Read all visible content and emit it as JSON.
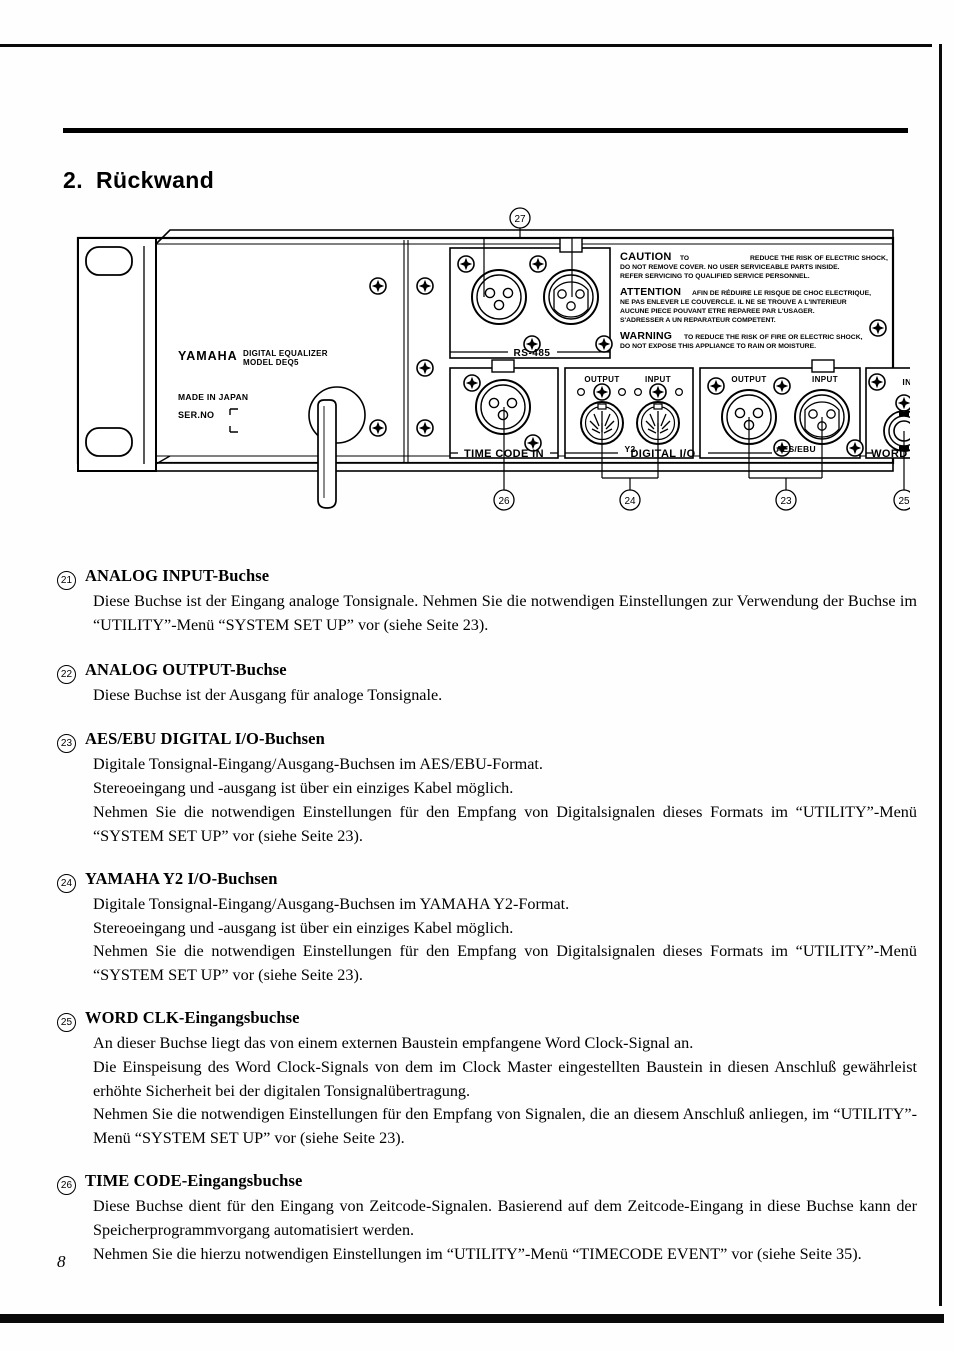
{
  "document": {
    "chapter_number": "2.",
    "chapter_title": "Rückwand",
    "page_number": "8"
  },
  "figure": {
    "name": "rear-panel-diagram",
    "brand": "YAMAHA",
    "product_line_1": "DIGITAL EQUALIZER",
    "product_line_2": "MODEL DEQ5",
    "made_in": "MADE IN JAPAN",
    "serial_label": "SER.NO",
    "rs485_label": "RS-485",
    "caution": {
      "caution_word": "CAUTION",
      "caution_to": "TO",
      "caution_line1": "REDUCE THE RISK OF ELECTRIC SHOCK,",
      "caution_line2": "DO NOT REMOVE COVER. NO USER SERVICEABLE PARTS INSIDE.",
      "caution_line3": "REFER SERVICING TO QUALIFIED SERVICE PERSONNEL.",
      "attention_word": "ATTENTION",
      "attention_line1": "AFIN DE RÉDUIRE LE RISQUE DE CHOC ELECTRIQUE,",
      "attention_line2": "NE PAS ENLEVER LE COUVERCLE. IL NE SE TROUVE A L'INTERIEUR",
      "attention_line3": "AUCUNE PIECE POUVANT ETRE REPAREE PAR L'USAGER.",
      "attention_line4": "S'ADRESSER A UN REPARATEUR COMPETENT.",
      "warning_word": "WARNING",
      "warning_line1": "TO REDUCE THE RISK OF FIRE OR ELECTRIC SHOCK,",
      "warning_line2": "DO NOT EXPOSE THIS APPLIANCE TO RAIN OR MOISTURE."
    },
    "connector_labels": {
      "time_code_in": "TIME CODE IN",
      "y2_output": "OUTPUT",
      "y2_input": "INPUT",
      "y2": "Y2",
      "digital_io": "DIGITAL I/O",
      "aes_output": "OUTPUT",
      "aes_input": "INPUT",
      "aes_ebu": "AES/EBU",
      "word_clk": "WORD CLK",
      "word_clk_in": "IN"
    },
    "callouts": {
      "c27": "27",
      "c26": "26",
      "c24": "24",
      "c23": "23",
      "c25": "25"
    }
  },
  "sections": [
    {
      "callout": "21",
      "title": "ANALOG INPUT-Buchse",
      "lines": [
        "Diese Buchse ist der Eingang analoge Tonsignale. Nehmen Sie die notwendigen Einstellungen zur Verwendung der Buchse im “UTILITY”-Menü “SYSTEM SET UP” vor (siehe Seite 23)."
      ]
    },
    {
      "callout": "22",
      "title": "ANALOG OUTPUT-Buchse",
      "lines": [
        "Diese Buchse ist der Ausgang für analoge Tonsignale."
      ]
    },
    {
      "callout": "23",
      "title": "AES/EBU DIGITAL I/O-Buchsen",
      "lines": [
        "Digitale Tonsignal-Eingang/Ausgang-Buchsen im AES/EBU-Format.",
        "Stereoeingang und -ausgang ist über ein einziges Kabel möglich.",
        "Nehmen Sie die notwendigen Einstellungen für den Empfang von Digitalsignalen dieses Formats im “UTILITY”-Menü “SYSTEM SET UP” vor (siehe Seite 23)."
      ]
    },
    {
      "callout": "24",
      "title": "YAMAHA Y2 I/O-Buchsen",
      "lines": [
        "Digitale Tonsignal-Eingang/Ausgang-Buchsen im YAMAHA Y2-Format.",
        "Stereoeingang und -ausgang ist über ein einziges Kabel möglich.",
        "Nehmen Sie die notwendigen Einstellungen für den Empfang von Digitalsignalen dieses Formats im “UTILITY”-Menü “SYSTEM SET UP” vor (siehe Seite 23)."
      ]
    },
    {
      "callout": "25",
      "title": "WORD CLK-Eingangsbuchse",
      "lines": [
        "An dieser Buchse liegt das von einem externen Baustein empfangene Word Clock-Signal an.",
        "Die Einspeisung des Word Clock-Signals von dem im Clock Master eingestellten Baustein in diesen Anschluß gewährleist erhöhte Sicherheit bei der digitalen Tonsignalübertragung.",
        "Nehmen Sie die notwendigen Einstellungen für den Empfang von Signalen, die an diesem Anschluß anliegen, im “UTILITY”-Menü “SYSTEM SET UP” vor (siehe Seite 23)."
      ]
    },
    {
      "callout": "26",
      "title": "TIME CODE-Eingangsbuchse",
      "lines": [
        "Diese Buchse dient für den Eingang von Zeitcode-Signalen. Basierend auf dem Zeitcode-Eingang in diese Buchse kann der Speicherprogrammvorgang automatisiert werden.",
        "Nehmen Sie die hierzu notwendigen Einstellungen im “UTILITY”-Menü “TIMECODE EVENT” vor (siehe Seite 35)."
      ]
    }
  ]
}
